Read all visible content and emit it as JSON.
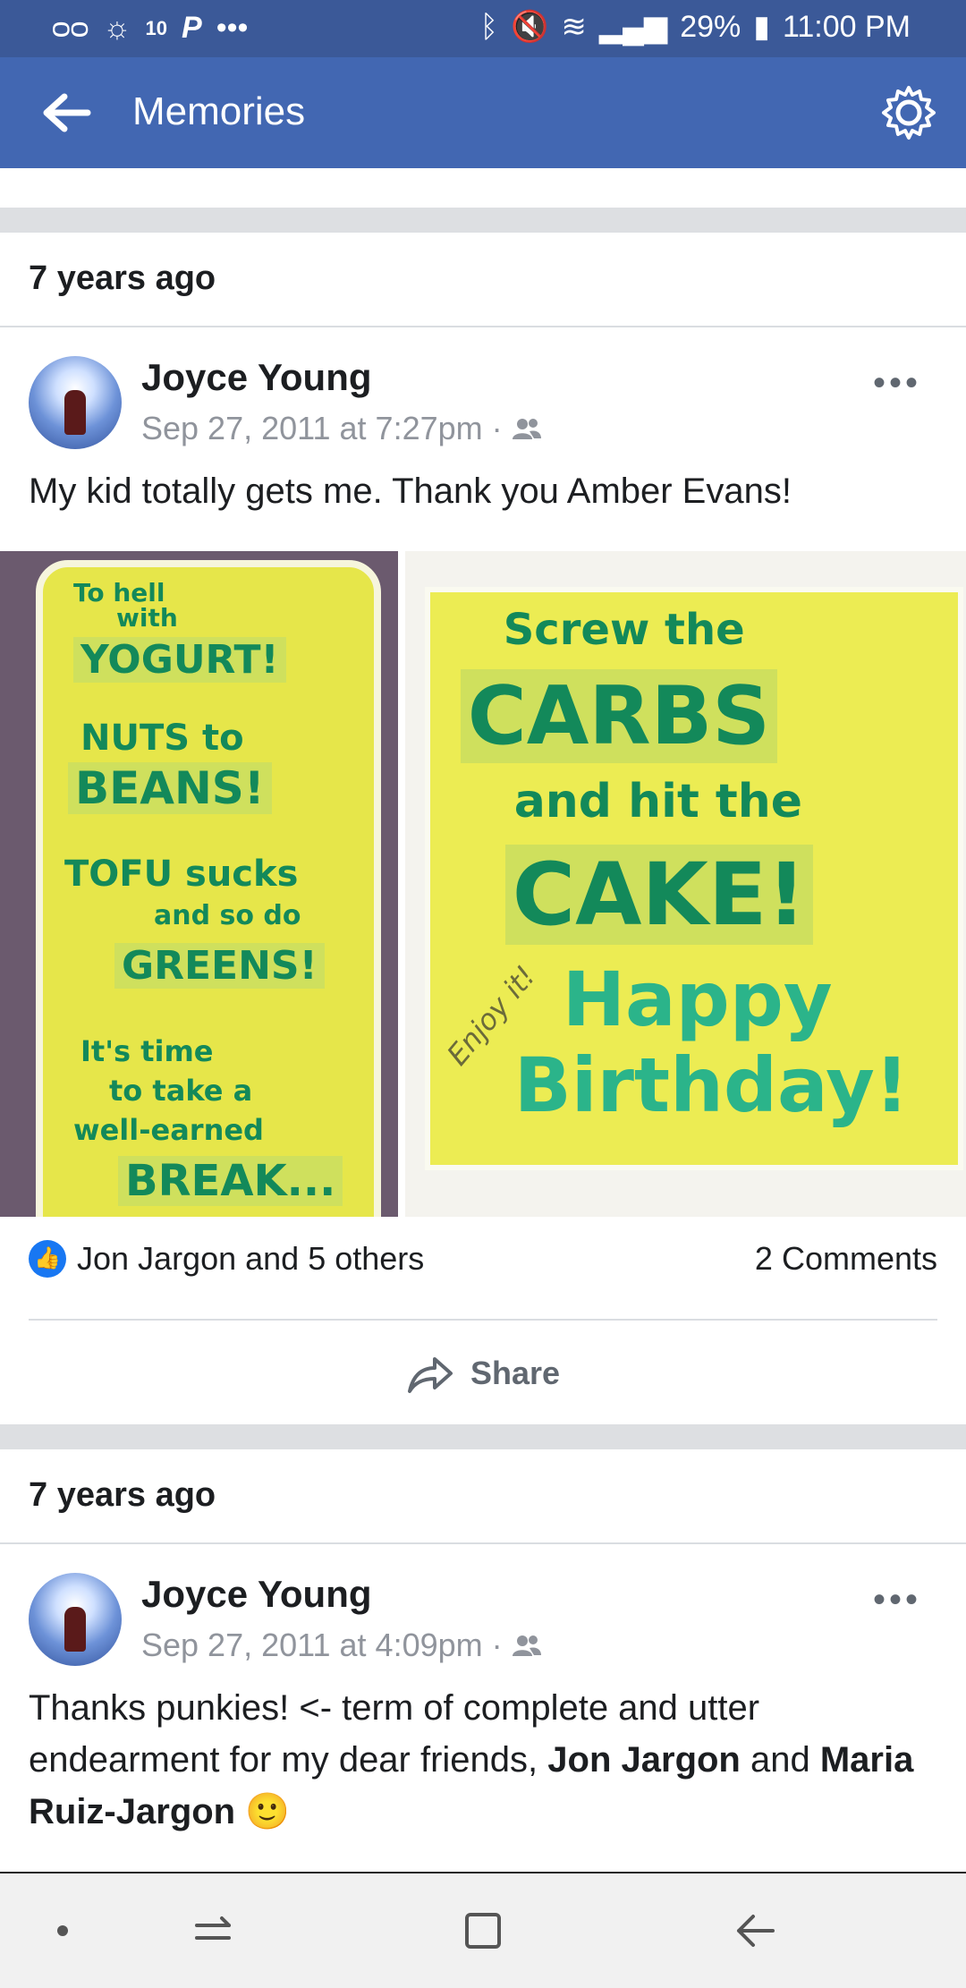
{
  "status_bar": {
    "notif_count": "10",
    "battery_percent": "29%",
    "time": "11:00 PM"
  },
  "app_bar": {
    "title": "Memories"
  },
  "memories": [
    {
      "label": "7 years ago",
      "author": "Joyce Young",
      "date": "Sep 27, 2011 at 7:27pm",
      "text": "My kid totally gets me. Thank you Amber Evans!",
      "photo_left_lines": [
        "To hell",
        "with",
        "YOGURT!",
        "NUTS to",
        "BEANS!",
        "TOFU sucks",
        "and so do",
        "GREENS!",
        "It's time",
        "to take a",
        "well-earned",
        "BREAK..."
      ],
      "photo_right_lines": [
        "Screw the",
        "CARBS",
        "and hit the",
        "CAKE!",
        "Enjoy it!",
        "Happy",
        "Birthday!"
      ],
      "likes": "Jon Jargon and 5 others",
      "comments": "2 Comments",
      "share_label": "Share"
    },
    {
      "label": "7 years ago",
      "author": "Joyce Young",
      "date": "Sep 27, 2011 at 4:09pm",
      "text_parts": {
        "a": "Thanks punkies! <- term of complete and utter endearment for my dear friends, ",
        "b": "Jon Jargon",
        "c": " and ",
        "d": "Maria Ruiz-Jargon",
        "e": " 🙂"
      }
    }
  ],
  "colors": {
    "header": "#4267b2",
    "status": "#3b5998",
    "like_blue": "#1877f2"
  }
}
